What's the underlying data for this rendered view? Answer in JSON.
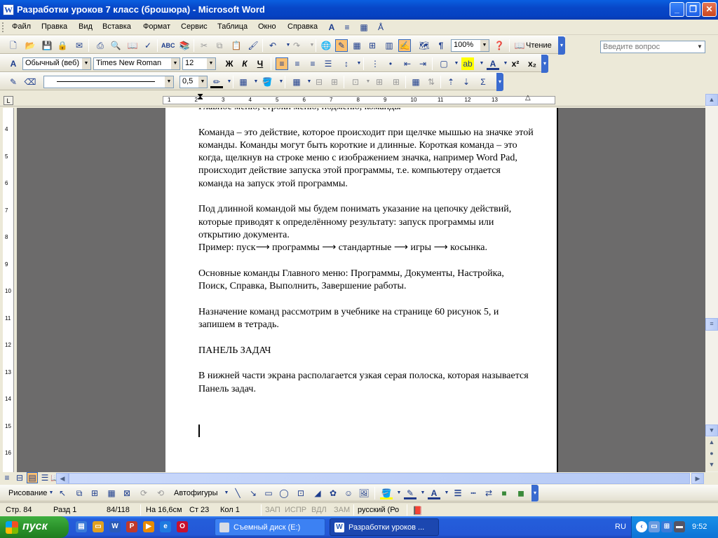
{
  "window": {
    "title": "Разработки уроков 7 класс (брошюра) - Microsoft Word",
    "app_icon": "W"
  },
  "menu": {
    "items": [
      "Файл",
      "Правка",
      "Вид",
      "Вставка",
      "Формат",
      "Сервис",
      "Таблица",
      "Окно",
      "Справка"
    ],
    "ask_placeholder": "Введите вопрос"
  },
  "standard_toolbar": {
    "zoom": "100%",
    "read_label": "Чтение"
  },
  "format_toolbar": {
    "style": "Обычный (веб)",
    "font": "Times New Roman",
    "size": "12",
    "bold": "Ж",
    "italic": "К",
    "underline": "Ч"
  },
  "border_toolbar": {
    "line_weight": "0,5"
  },
  "ruler": {
    "h_numbers": [
      "1",
      "2",
      "3",
      "4",
      "5",
      "6",
      "7",
      "8",
      "9",
      "10",
      "11",
      "12",
      "13"
    ],
    "v_numbers": [
      "4",
      "5",
      "6",
      "7",
      "8",
      "9",
      "10",
      "11",
      "12",
      "13",
      "14",
      "15",
      "16"
    ]
  },
  "document": {
    "paragraphs": [
      "Главное меню, строки меню, подменю, команды",
      "Команда – это действие, которое происходит при щелчке мышью на значке этой команды. Команды могут быть короткие и длинные. Короткая команда – это когда, щелкнув на строке меню с изображением значка, например Word Pad, происходит действие запуска этой программы, т.е. компьютеру отдается команда на запуск этой программы.",
      "Под длинной командой мы будем понимать указание на цепочку действий, которые приводят к определённому результату: запуск программы или открытию документа.\nПример: пуск⟶ программы ⟶ стандартные ⟶ игры ⟶ косынка.",
      "Основные команды Главного меню: Программы, Документы, Настройка, Поиск, Справка, Выполнить, Завершение работы.",
      "Назначение команд рассмотрим в учебнике на странице 60 рисунок 5, и запишем в тетрадь.",
      "ПАНЕЛЬ ЗАДАЧ",
      "В нижней части экрана располагается узкая серая полоска, которая называется Панель задач."
    ]
  },
  "drawing_toolbar": {
    "draw_label": "Рисование",
    "autoshapes_label": "Автофигуры"
  },
  "status": {
    "page": "Стр. 84",
    "section": "Разд 1",
    "pages": "84/118",
    "at": "На 16,6см",
    "line": "Ст 23",
    "col": "Кол 1",
    "rec": "ЗАП",
    "trk": "ИСПР",
    "ext": "ВДЛ",
    "ovr": "ЗАМ",
    "lang": "русский (Ро"
  },
  "taskbar": {
    "start_label": "пуск",
    "tasks": [
      "Съемный диск (E:)",
      "Разработки уроков ..."
    ],
    "lang": "RU",
    "clock": "9:52"
  }
}
